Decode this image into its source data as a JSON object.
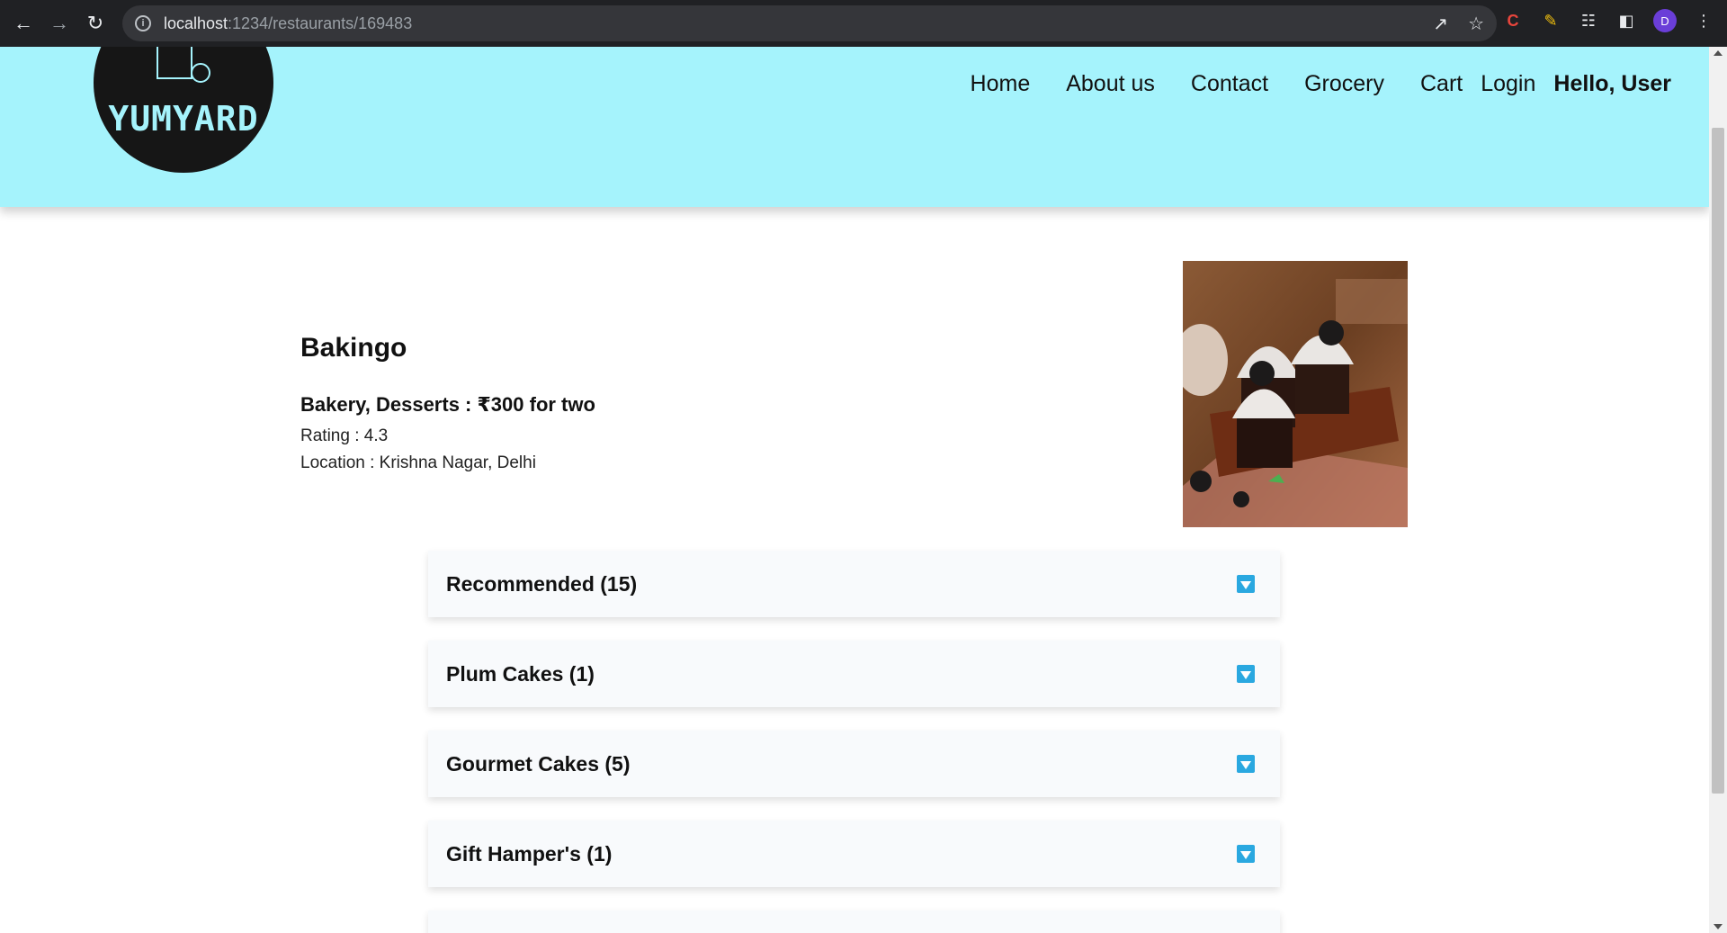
{
  "browser": {
    "url_host": "localhost",
    "url_path": ":1234/restaurants/169483",
    "profile_initial": "D"
  },
  "header": {
    "logo_text": "YUMYARD",
    "nav": [
      "Home",
      "About us",
      "Contact",
      "Grocery",
      "Cart",
      "Login"
    ],
    "greeting": "Hello, User",
    "bg_color": "#a5f3fc"
  },
  "restaurant": {
    "name": "Bakingo",
    "cuisine_line": "Bakery, Desserts : ₹300 for two",
    "rating_line": "Rating : 4.3",
    "location_line": "Location : Krishna Nagar, Delhi",
    "image_icon": "cupcake-photo"
  },
  "menu_sections": [
    {
      "title": "Recommended (15)"
    },
    {
      "title": "Plum Cakes (1)"
    },
    {
      "title": "Gourmet Cakes (5)"
    },
    {
      "title": "Gift Hamper's (1)"
    }
  ],
  "colors": {
    "accordion_toggle": "#2aa8e0",
    "accordion_bg": "#f8fafc"
  }
}
